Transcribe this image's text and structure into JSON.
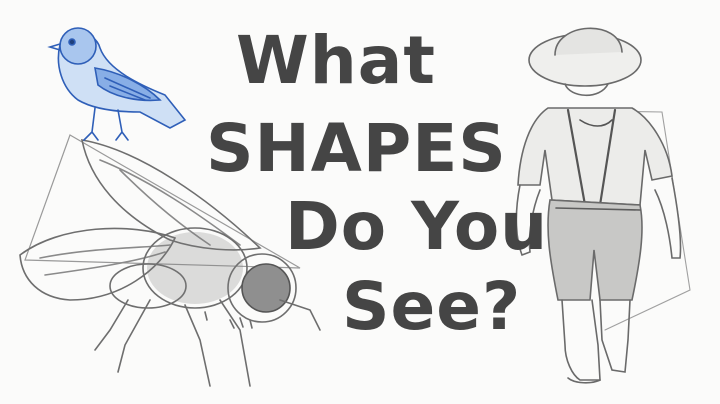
{
  "title": {
    "line1": "What",
    "line2": "SHAPES",
    "line3": "Do You",
    "line4": "See?"
  },
  "illustrations": {
    "bird": "blue-pencil-bird-sketch",
    "fly": "pencil-housefly-sketch",
    "child": "pencil-child-walking-sketch"
  },
  "colors": {
    "background": "#fbfbfa",
    "title_text": "#454545",
    "pencil_gray": "#6b6b6b",
    "bird_blue": "#3f74c9"
  }
}
